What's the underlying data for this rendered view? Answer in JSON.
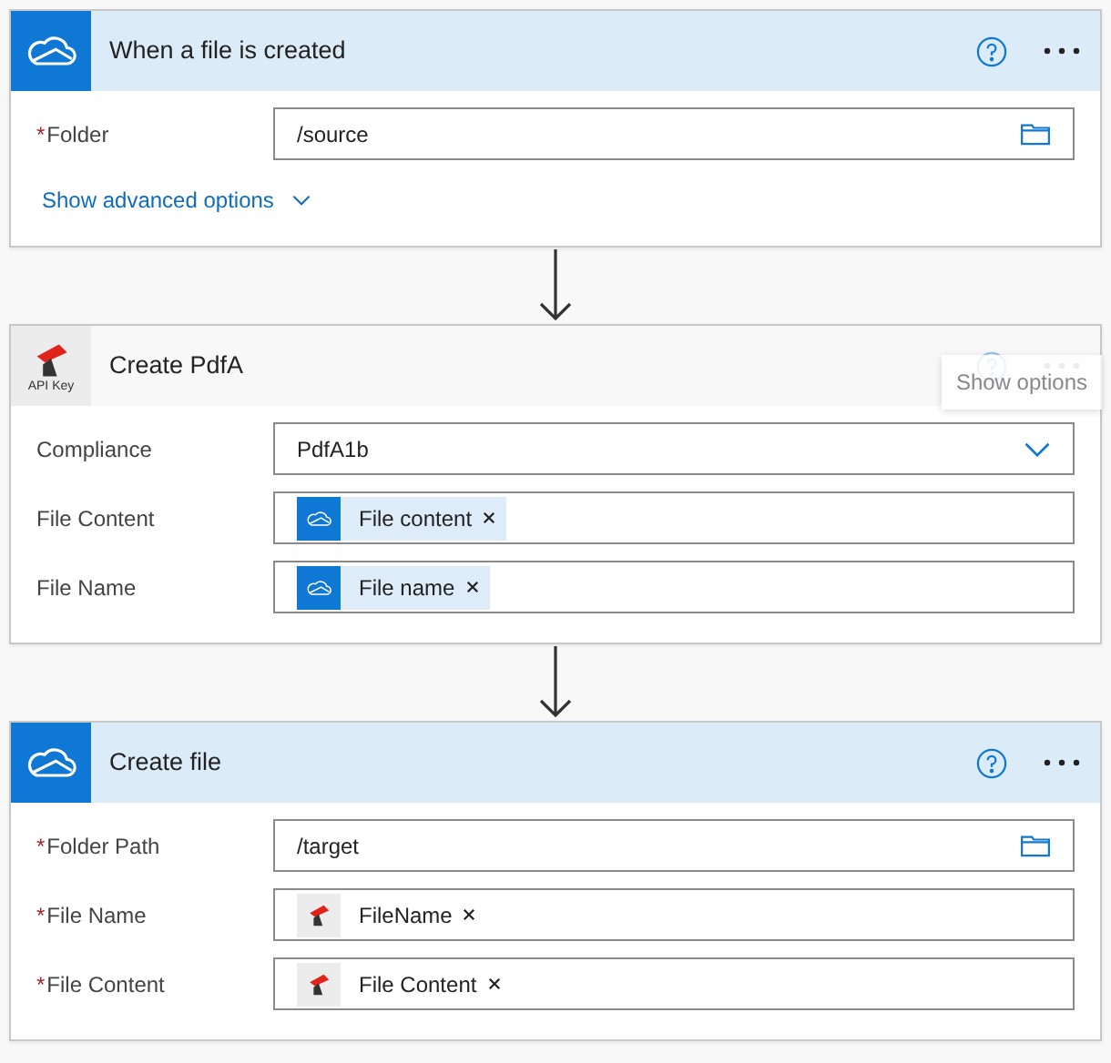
{
  "cards": [
    {
      "title": "When a file is created",
      "kind": "onedrive",
      "highlighted": true,
      "fields": [
        {
          "label": "Folder",
          "required_mark": "*",
          "kind": "folder",
          "value": "/source"
        }
      ],
      "advanced_link": "Show advanced options"
    },
    {
      "title": "Create PdfA",
      "kind": "api_key",
      "connector_label": "API Key",
      "highlighted": false,
      "tooltip": "Show options",
      "fields": [
        {
          "label": "Compliance",
          "kind": "dropdown",
          "value": "PdfA1b"
        },
        {
          "label": "File Content",
          "kind": "tokens",
          "tokens": [
            {
              "label": "File content",
              "kind": "onedrive"
            }
          ]
        },
        {
          "label": "File Name",
          "kind": "tokens",
          "tokens": [
            {
              "label": "File name",
              "kind": "onedrive"
            }
          ]
        }
      ]
    },
    {
      "title": "Create file",
      "kind": "onedrive",
      "highlighted": true,
      "fields": [
        {
          "label": "Folder Path",
          "required_mark": "*",
          "kind": "folder",
          "value": "/target"
        },
        {
          "label": "File Name",
          "required_mark": "*",
          "kind": "tokens",
          "tokens": [
            {
              "label": "FileName",
              "kind": "api_key"
            }
          ]
        },
        {
          "label": "File Content",
          "required_mark": "*",
          "kind": "tokens",
          "tokens": [
            {
              "label": "File Content",
              "kind": "api_key"
            }
          ]
        }
      ]
    }
  ]
}
